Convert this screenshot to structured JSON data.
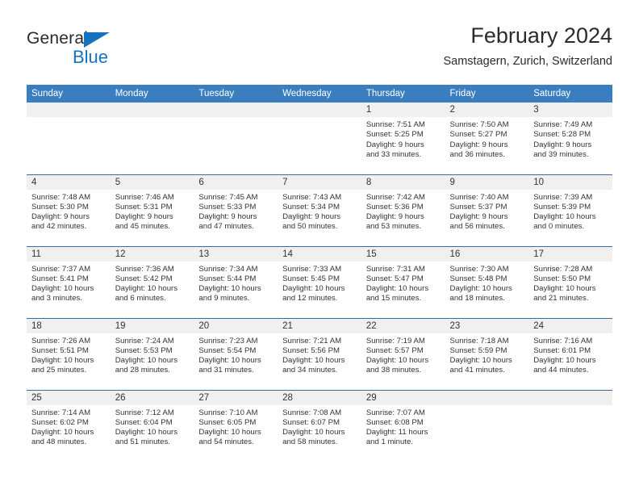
{
  "brand": {
    "name_dark": "General",
    "name_blue": "Blue",
    "flag_icon": "triangle-flag-icon",
    "accent_color": "#1572c0"
  },
  "header": {
    "title": "February 2024",
    "subtitle": "Samstagern, Zurich, Switzerland"
  },
  "calendar": {
    "header_bg": "#3b7ebf",
    "daynum_bg": "#f0f0f0",
    "weekdays": [
      "Sunday",
      "Monday",
      "Tuesday",
      "Wednesday",
      "Thursday",
      "Friday",
      "Saturday"
    ],
    "weeks": [
      [
        {
          "day": "",
          "lines": []
        },
        {
          "day": "",
          "lines": []
        },
        {
          "day": "",
          "lines": []
        },
        {
          "day": "",
          "lines": []
        },
        {
          "day": "1",
          "lines": [
            "Sunrise: 7:51 AM",
            "Sunset: 5:25 PM",
            "Daylight: 9 hours",
            "and 33 minutes."
          ]
        },
        {
          "day": "2",
          "lines": [
            "Sunrise: 7:50 AM",
            "Sunset: 5:27 PM",
            "Daylight: 9 hours",
            "and 36 minutes."
          ]
        },
        {
          "day": "3",
          "lines": [
            "Sunrise: 7:49 AM",
            "Sunset: 5:28 PM",
            "Daylight: 9 hours",
            "and 39 minutes."
          ]
        }
      ],
      [
        {
          "day": "4",
          "lines": [
            "Sunrise: 7:48 AM",
            "Sunset: 5:30 PM",
            "Daylight: 9 hours",
            "and 42 minutes."
          ]
        },
        {
          "day": "5",
          "lines": [
            "Sunrise: 7:46 AM",
            "Sunset: 5:31 PM",
            "Daylight: 9 hours",
            "and 45 minutes."
          ]
        },
        {
          "day": "6",
          "lines": [
            "Sunrise: 7:45 AM",
            "Sunset: 5:33 PM",
            "Daylight: 9 hours",
            "and 47 minutes."
          ]
        },
        {
          "day": "7",
          "lines": [
            "Sunrise: 7:43 AM",
            "Sunset: 5:34 PM",
            "Daylight: 9 hours",
            "and 50 minutes."
          ]
        },
        {
          "day": "8",
          "lines": [
            "Sunrise: 7:42 AM",
            "Sunset: 5:36 PM",
            "Daylight: 9 hours",
            "and 53 minutes."
          ]
        },
        {
          "day": "9",
          "lines": [
            "Sunrise: 7:40 AM",
            "Sunset: 5:37 PM",
            "Daylight: 9 hours",
            "and 56 minutes."
          ]
        },
        {
          "day": "10",
          "lines": [
            "Sunrise: 7:39 AM",
            "Sunset: 5:39 PM",
            "Daylight: 10 hours",
            "and 0 minutes."
          ]
        }
      ],
      [
        {
          "day": "11",
          "lines": [
            "Sunrise: 7:37 AM",
            "Sunset: 5:41 PM",
            "Daylight: 10 hours",
            "and 3 minutes."
          ]
        },
        {
          "day": "12",
          "lines": [
            "Sunrise: 7:36 AM",
            "Sunset: 5:42 PM",
            "Daylight: 10 hours",
            "and 6 minutes."
          ]
        },
        {
          "day": "13",
          "lines": [
            "Sunrise: 7:34 AM",
            "Sunset: 5:44 PM",
            "Daylight: 10 hours",
            "and 9 minutes."
          ]
        },
        {
          "day": "14",
          "lines": [
            "Sunrise: 7:33 AM",
            "Sunset: 5:45 PM",
            "Daylight: 10 hours",
            "and 12 minutes."
          ]
        },
        {
          "day": "15",
          "lines": [
            "Sunrise: 7:31 AM",
            "Sunset: 5:47 PM",
            "Daylight: 10 hours",
            "and 15 minutes."
          ]
        },
        {
          "day": "16",
          "lines": [
            "Sunrise: 7:30 AM",
            "Sunset: 5:48 PM",
            "Daylight: 10 hours",
            "and 18 minutes."
          ]
        },
        {
          "day": "17",
          "lines": [
            "Sunrise: 7:28 AM",
            "Sunset: 5:50 PM",
            "Daylight: 10 hours",
            "and 21 minutes."
          ]
        }
      ],
      [
        {
          "day": "18",
          "lines": [
            "Sunrise: 7:26 AM",
            "Sunset: 5:51 PM",
            "Daylight: 10 hours",
            "and 25 minutes."
          ]
        },
        {
          "day": "19",
          "lines": [
            "Sunrise: 7:24 AM",
            "Sunset: 5:53 PM",
            "Daylight: 10 hours",
            "and 28 minutes."
          ]
        },
        {
          "day": "20",
          "lines": [
            "Sunrise: 7:23 AM",
            "Sunset: 5:54 PM",
            "Daylight: 10 hours",
            "and 31 minutes."
          ]
        },
        {
          "day": "21",
          "lines": [
            "Sunrise: 7:21 AM",
            "Sunset: 5:56 PM",
            "Daylight: 10 hours",
            "and 34 minutes."
          ]
        },
        {
          "day": "22",
          "lines": [
            "Sunrise: 7:19 AM",
            "Sunset: 5:57 PM",
            "Daylight: 10 hours",
            "and 38 minutes."
          ]
        },
        {
          "day": "23",
          "lines": [
            "Sunrise: 7:18 AM",
            "Sunset: 5:59 PM",
            "Daylight: 10 hours",
            "and 41 minutes."
          ]
        },
        {
          "day": "24",
          "lines": [
            "Sunrise: 7:16 AM",
            "Sunset: 6:01 PM",
            "Daylight: 10 hours",
            "and 44 minutes."
          ]
        }
      ],
      [
        {
          "day": "25",
          "lines": [
            "Sunrise: 7:14 AM",
            "Sunset: 6:02 PM",
            "Daylight: 10 hours",
            "and 48 minutes."
          ]
        },
        {
          "day": "26",
          "lines": [
            "Sunrise: 7:12 AM",
            "Sunset: 6:04 PM",
            "Daylight: 10 hours",
            "and 51 minutes."
          ]
        },
        {
          "day": "27",
          "lines": [
            "Sunrise: 7:10 AM",
            "Sunset: 6:05 PM",
            "Daylight: 10 hours",
            "and 54 minutes."
          ]
        },
        {
          "day": "28",
          "lines": [
            "Sunrise: 7:08 AM",
            "Sunset: 6:07 PM",
            "Daylight: 10 hours",
            "and 58 minutes."
          ]
        },
        {
          "day": "29",
          "lines": [
            "Sunrise: 7:07 AM",
            "Sunset: 6:08 PM",
            "Daylight: 11 hours",
            "and 1 minute."
          ]
        },
        {
          "day": "",
          "lines": []
        },
        {
          "day": "",
          "lines": []
        }
      ]
    ]
  }
}
